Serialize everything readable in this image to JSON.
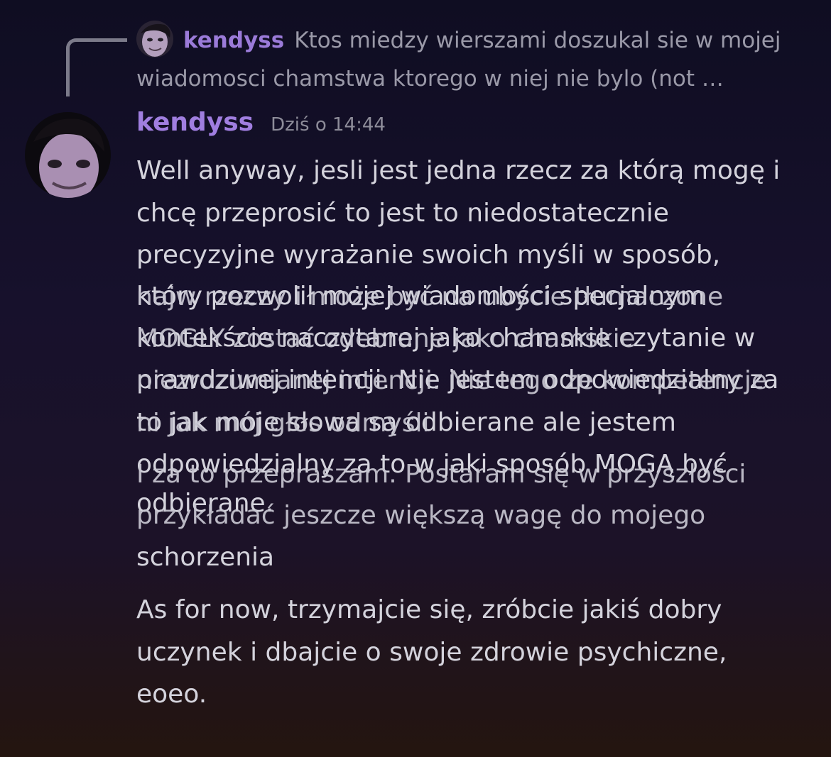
{
  "reply": {
    "author": "kendyss",
    "preview": "Ktos miedzy wierszami doszukal sie w mojej wiadomosci chamstwa ktorego w niej nie bylo (not …"
  },
  "message": {
    "author": "kendyss",
    "timestamp": "Dziś o 14:44",
    "paragraph1_lines": [
      "Well anyway, jesli jest jedna rzecz za którą mogę i",
      "chcę przeprosić to jest to niedostatecznie",
      "precyzyjne wyrażanie swoich myśli w sposób,"
    ],
    "overlap_a_lines": [
      "który pozwolił mojej wiadomości specjalnym",
      "kontekście naczytanej jako chamskie czytanie w",
      "prawdziwej intencji. Nie jestem odpowiedzialny za",
      "to jak moje słowa są odbierane ale jestem",
      "odpowiedzialny za to w jaki sposób MOGĄ być",
      "odbierane."
    ],
    "overlap_b_lines": [
      "najw rzeczy i może być na ubycie tłumaczone",
      "MOGLY zostać odebrane jako chamskie",
      "niezrozumianej intencji. Nie tego ze kompetencje",
      "ni jak mój głos odmyśli",
      "I za to przepraszam. Postaram się w przyszłości",
      "przykładać jeszcze większą wagę do mojego"
    ],
    "paragraph2_tail": "schorzenia",
    "paragraph3_lines": [
      "As for now, trzymajcie się, zróbcie jakiś dobry",
      "uczynek i dbajcie o swoje zdrowie psychiczne,",
      "eoeo."
    ]
  },
  "colors": {
    "author": "#a07ee0",
    "text": "#d4d3dc",
    "muted": "#8d8c99",
    "background_top": "#0f0d22",
    "background_bottom": "#24150f"
  }
}
